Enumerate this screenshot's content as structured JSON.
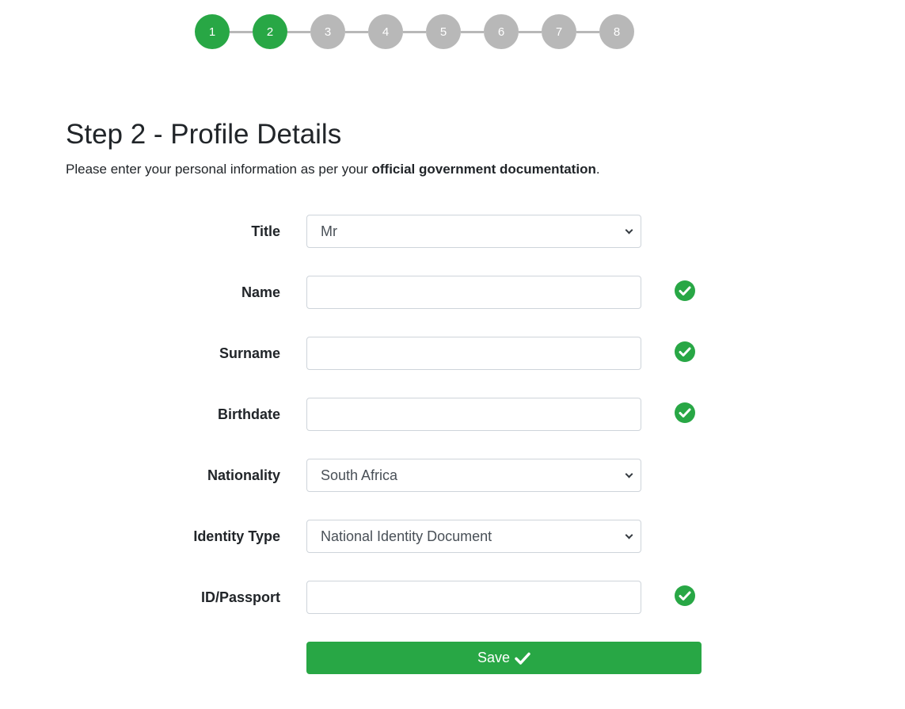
{
  "stepper": {
    "steps": [
      "1",
      "2",
      "3",
      "4",
      "5",
      "6",
      "7",
      "8"
    ],
    "active_color": "#28a745",
    "inactive_color": "#b8b8b8"
  },
  "header": {
    "title": "Step 2 - Profile Details",
    "intro_prefix": "Please enter your personal information as per your ",
    "intro_bold": "official government documentation",
    "intro_suffix": "."
  },
  "form": {
    "title": {
      "label": "Title",
      "value": "Mr"
    },
    "name": {
      "label": "Name",
      "value": ""
    },
    "surname": {
      "label": "Surname",
      "value": ""
    },
    "birthdate": {
      "label": "Birthdate",
      "value": ""
    },
    "nationality": {
      "label": "Nationality",
      "value": "South Africa"
    },
    "identity_type": {
      "label": "Identity Type",
      "value": "National Identity Document"
    },
    "id_passport": {
      "label": "ID/Passport",
      "value": ""
    }
  },
  "save_label": "Save",
  "valid_icon": "check-circle-icon",
  "valid_color": "#28a745"
}
